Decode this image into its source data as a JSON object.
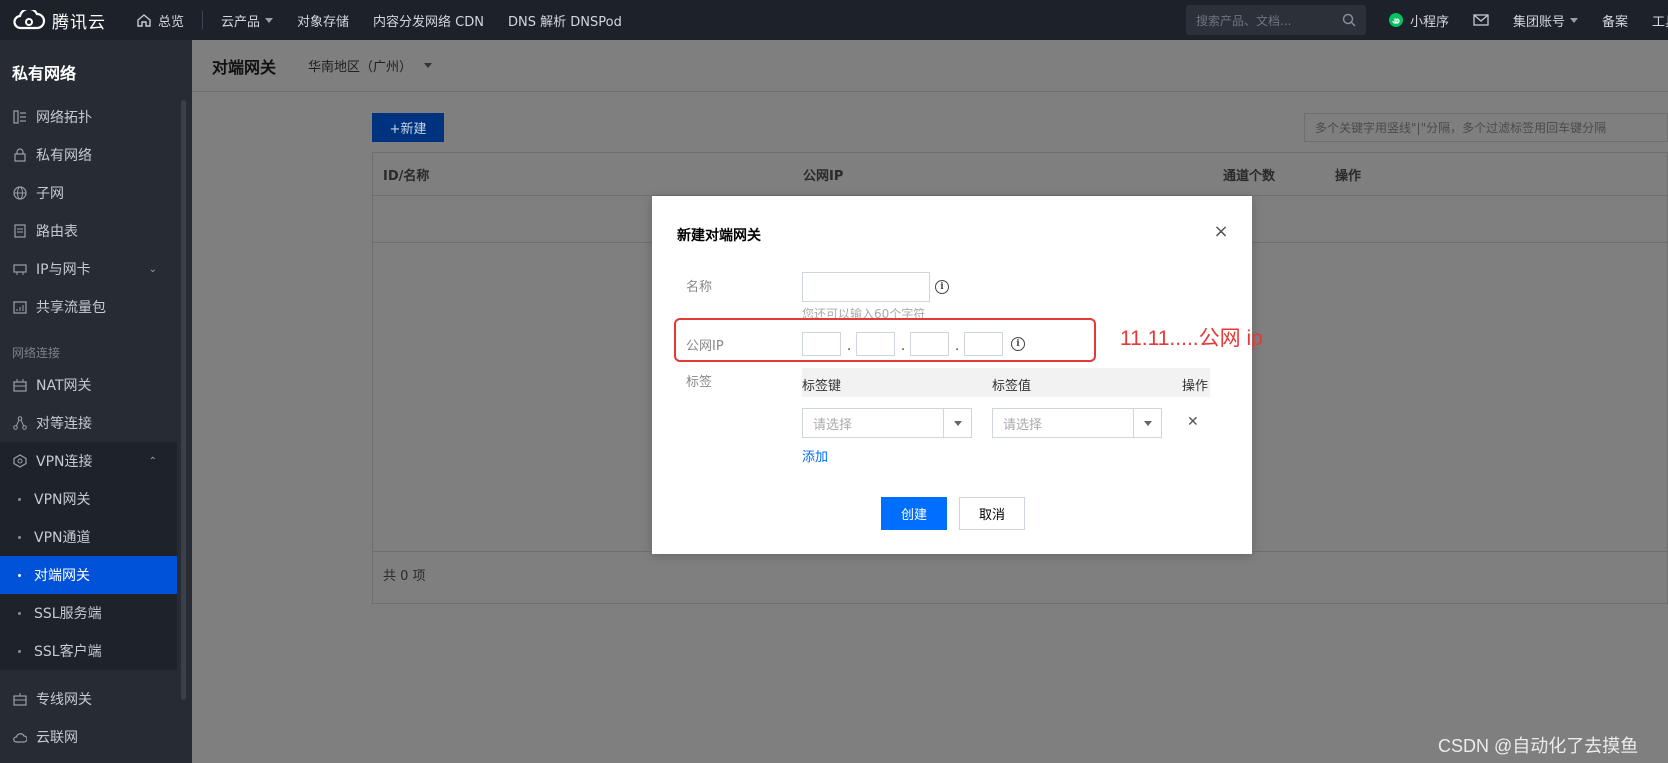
{
  "topbar": {
    "brand": "腾讯云",
    "home": "总览",
    "products": "云产品",
    "links": [
      "对象存储",
      "内容分发网络 CDN",
      "DNS 解析 DNSPod"
    ],
    "search_placeholder": "搜索产品、文档...",
    "mini_program": "小程序",
    "account": "集团账号",
    "record": "备案",
    "tools": "工具"
  },
  "sidebar": {
    "title": "私有网络",
    "items": [
      {
        "label": "网络拓扑",
        "icon": "topology-icon"
      },
      {
        "label": "私有网络",
        "icon": "lock-icon"
      },
      {
        "label": "子网",
        "icon": "globe-icon"
      },
      {
        "label": "路由表",
        "icon": "document-icon"
      },
      {
        "label": "IP与网卡",
        "icon": "nic-icon"
      },
      {
        "label": "共享流量包",
        "icon": "package-icon"
      }
    ],
    "section_label": "网络连接",
    "items2": [
      {
        "label": "NAT网关",
        "icon": "nat-icon"
      },
      {
        "label": "对等连接",
        "icon": "peering-icon"
      },
      {
        "label": "VPN连接",
        "icon": "vpn-icon"
      }
    ],
    "vpn_sub": [
      "VPN网关",
      "VPN通道",
      "对端网关",
      "SSL服务端",
      "SSL客户端"
    ],
    "items3": [
      {
        "label": "专线网关",
        "icon": "dc-gateway-icon"
      },
      {
        "label": "云联网",
        "icon": "ccn-icon"
      }
    ]
  },
  "page": {
    "title": "对端网关",
    "region": "华南地区（广州）",
    "new_button": "+新建",
    "filter_placeholder": "多个关键字用竖线\"|\"分隔，多个过滤标签用回车键分隔",
    "columns": [
      "ID/名称",
      "公网IP",
      "通道个数",
      "操作"
    ],
    "total": "共 0 项"
  },
  "modal": {
    "title": "新建对端网关",
    "name_label": "名称",
    "name_value": "",
    "name_hint": "您还可以输入60个字符",
    "ip_label": "公网IP",
    "ip_values": [
      "",
      "",
      "",
      ""
    ],
    "tag_label": "标签",
    "tag_key_header": "标签键",
    "tag_value_header": "标签值",
    "tag_op_header": "操作",
    "select_placeholder": "请选择",
    "add_link": "添加",
    "create_button": "创建",
    "cancel_button": "取消"
  },
  "annotation": {
    "note": "11.11.....公网 ip",
    "color": "#e53935"
  },
  "watermark": "CSDN @自动化了去摸鱼",
  "colors": {
    "topbar": "#1d2129",
    "sidebar": "#262b34",
    "active": "#0052d9",
    "primary": "#006eff"
  }
}
